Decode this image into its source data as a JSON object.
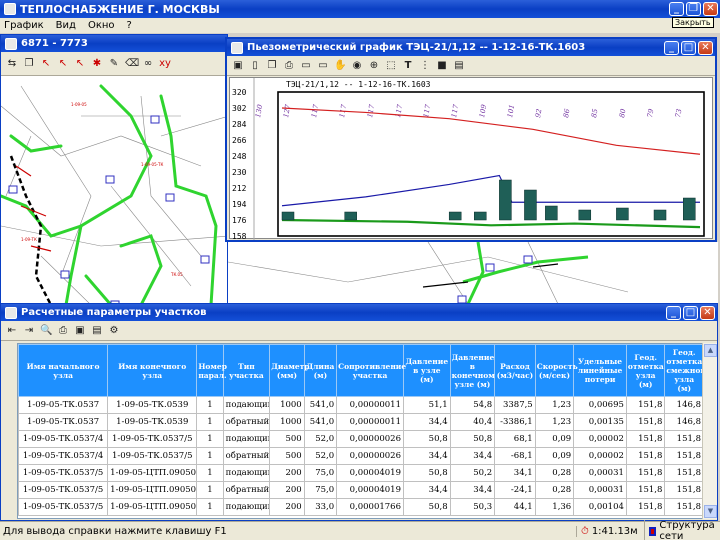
{
  "main": {
    "title": "ТЕПЛОСНАБЖЕНИЕ Г. МОСКВЫ",
    "menu": [
      "График",
      "Вид",
      "Окно",
      "?"
    ],
    "tooltip": "Закрыть"
  },
  "map_window": {
    "title": "6871 - 7773"
  },
  "piezo_window": {
    "title": "Пьезометрический график ТЭЦ-21/1,12 -- 1-12-16-ТК.1603",
    "chart_data": {
      "type": "line",
      "title": "ТЭЦ-21/1,12 -- 1-12-16-ТК.1603",
      "y_ticks": [
        320,
        302,
        284,
        266,
        248,
        230,
        212,
        194,
        176,
        158
      ],
      "ylim": [
        158,
        320
      ],
      "annotations": [
        "130",
        "127",
        "117",
        "117",
        "117",
        "117",
        "117",
        "117",
        "109",
        "101",
        "92",
        "86",
        "85",
        "80",
        "79",
        "73"
      ],
      "series": [
        {
          "color": "#d42020",
          "values": [
            [
              0,
              302
            ],
            [
              0.2,
              297
            ],
            [
              0.4,
              290
            ],
            [
              0.6,
              278
            ],
            [
              0.8,
              260
            ],
            [
              1,
              250
            ]
          ]
        },
        {
          "color": "#1a1aa8",
          "values": [
            [
              0,
              192
            ],
            [
              0.2,
              202
            ],
            [
              0.4,
              216
            ],
            [
              0.52,
              226
            ],
            [
              0.55,
              196
            ],
            [
              1,
              196
            ]
          ]
        },
        {
          "color": "#1a9a1a",
          "values": [
            [
              0,
              176
            ],
            [
              0.3,
              174
            ],
            [
              0.5,
              170
            ],
            [
              0.7,
              172
            ],
            [
              1,
              168
            ]
          ]
        }
      ]
    }
  },
  "param_window": {
    "title": "Расчетные параметры участков",
    "columns": [
      "Имя начального узла",
      "Имя конечного узла",
      "Номер парал.",
      "Тип участка",
      "Диаметр (мм)",
      "Длина (м)",
      "Сопротивление участка",
      "Давление в узле (м)",
      "Давление в конечном узле (м)",
      "Расход (м3/час)",
      "Скорость (м/сек)",
      "Удельные линейные потери",
      "Геод. отметка узла (м)",
      "Геод. отметка смежного узла (м)"
    ],
    "rows": [
      [
        "1-09-05-ТК.0537",
        "1-09-05-ТК.0539",
        "1",
        "подающий",
        "1000",
        "541,0",
        "0,00000011",
        "51,1",
        "54,8",
        "3387,5",
        "1,23",
        "0,00695",
        "151,8",
        "146,8"
      ],
      [
        "1-09-05-ТК.0537",
        "1-09-05-ТК.0539",
        "1",
        "обратный",
        "1000",
        "541,0",
        "0,00000011",
        "34,4",
        "40,4",
        "-3386,1",
        "1,23",
        "0,00135",
        "151,8",
        "146,8"
      ],
      [
        "1-09-05-ТК.0537/4",
        "1-09-05-ТК.0537/5",
        "1",
        "подающий",
        "500",
        "52,0",
        "0,00000026",
        "50,8",
        "50,8",
        "68,1",
        "0,09",
        "0,00002",
        "151,8",
        "151,8"
      ],
      [
        "1-09-05-ТК.0537/4",
        "1-09-05-ТК.0537/5",
        "1",
        "обратный",
        "500",
        "52,0",
        "0,00000026",
        "34,4",
        "34,4",
        "-68,1",
        "0,09",
        "0,00002",
        "151,8",
        "151,8"
      ],
      [
        "1-09-05-ТК.0537/5",
        "1-09-05-ЦТП.0905047",
        "1",
        "подающий",
        "200",
        "75,0",
        "0,00004019",
        "50,8",
        "50,2",
        "34,1",
        "0,28",
        "0,00031",
        "151,8",
        "151,8"
      ],
      [
        "1-09-05-ТК.0537/5",
        "1-09-05-ЦТП.0905047",
        "1",
        "обратный",
        "200",
        "75,0",
        "0,00004019",
        "34,4",
        "34,4",
        "-24,1",
        "0,28",
        "0,00031",
        "151,8",
        "151,8"
      ],
      [
        "1-09-05-ТК.0537/5",
        "1-09-05-ЦТП.0905048",
        "1",
        "подающий",
        "200",
        "33,0",
        "0,00001766",
        "50,8",
        "50,3",
        "44,1",
        "1,36",
        "0,00104",
        "151,8",
        "151,8"
      ]
    ]
  },
  "status": {
    "help": "Для вывода справки нажмите клавишу F1",
    "time": "1:41.13м",
    "structure": "Структура сети"
  }
}
